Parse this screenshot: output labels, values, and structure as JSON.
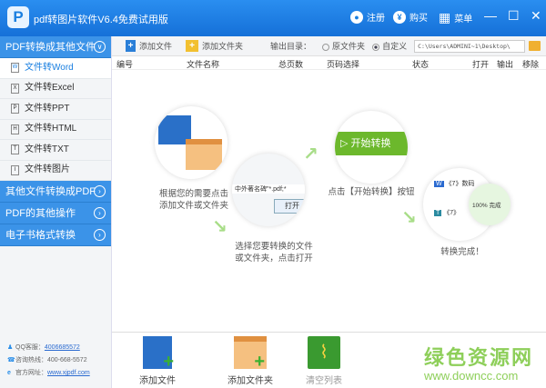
{
  "titlebar": {
    "logo": "P",
    "title": "pdf转图片软件V6.4免费试用版",
    "register": "注册",
    "buy": "购买",
    "menu": "菜单",
    "minimize": "—",
    "maximize": "☐",
    "close": "✕"
  },
  "sidebar": {
    "section1": "PDF转换成其他文件",
    "items": [
      {
        "label": "文件转Word",
        "icon": "W"
      },
      {
        "label": "文件转Excel",
        "icon": "X"
      },
      {
        "label": "文件转PPT",
        "icon": "P"
      },
      {
        "label": "文件转HTML",
        "icon": "H"
      },
      {
        "label": "文件转TXT",
        "icon": "T"
      },
      {
        "label": "文件转图片",
        "icon": "I"
      }
    ],
    "section2": "其他文件转换成PDF",
    "section3": "PDF的其他操作",
    "section4": "电子书格式转换"
  },
  "contact": {
    "qq_label": "QQ客服：",
    "qq": "4006685572",
    "phone_label": "咨询热线：",
    "phone": "400-668-5572",
    "site_label": "官方网址：",
    "site": "www.xjpdf.com"
  },
  "toolbar": {
    "add_file": "添加文件",
    "add_folder": "添加文件夹",
    "output_label": "输出目录：",
    "opt_original": "原文件夹",
    "opt_custom": "自定义",
    "path": "C:\\Users\\ADMINI~1\\Desktop\\"
  },
  "table": {
    "headers": [
      "编号",
      "文件名称",
      "总页数",
      "页码选择",
      "状态",
      "打开",
      "输出",
      "移除"
    ]
  },
  "guide": {
    "step1": "根据您的需要点击\n添加文件或文件夹",
    "step2": "选择您要转换的文件\n或文件夹，点击打开",
    "step3": "点击【开始转换】按钮",
    "step4": "转换完成！",
    "start_btn": "开始转换",
    "dialog_file": "中外著名碑\"*.pdf;*",
    "dialog_open": "打开",
    "result1": "《7》数码",
    "result2": "《7》",
    "progress": "100%",
    "done": "完成"
  },
  "bottom": {
    "add_file": "添加文件",
    "add_folder": "添加文件夹",
    "clear": "清空列表"
  },
  "watermark": {
    "name": "绿色资源网",
    "url": "www.downcc.com"
  }
}
